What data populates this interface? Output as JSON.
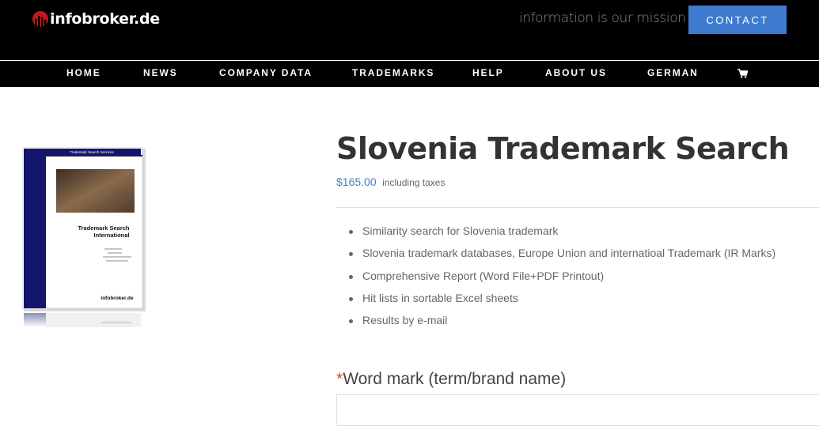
{
  "header": {
    "logo_text": "infobroker.de",
    "tagline": "information is our mission",
    "contact_label": "CONTACT"
  },
  "nav": {
    "items": [
      "HOME",
      "NEWS",
      "COMPANY DATA",
      "TRADEMARKS",
      "HELP",
      "ABOUT US",
      "GERMAN"
    ],
    "cart_icon": "shopping-cart-icon"
  },
  "product": {
    "image_title": "Trademark Search International",
    "image_brand": "infobroker.de",
    "image_header": "Trademark Search Services",
    "title": "Slovenia Trademark Search",
    "price": "$165.00",
    "tax_note": "including taxes",
    "features": [
      "Similarity search for Slovenia trademark",
      "Slovenia trademark databases, Europe Union and internatioal Trademark (IR Marks)",
      "Comprehensive Report (Word File+PDF Printout)",
      "Hit lists in sortable Excel sheets",
      "Results by e-mail"
    ]
  },
  "form": {
    "required_mark": "*",
    "word_mark_label": "Word mark (term/brand name)",
    "word_mark_value": ""
  },
  "colors": {
    "accent": "#3e7bd0",
    "header_bg": "#000000",
    "required": "#e0402f"
  }
}
